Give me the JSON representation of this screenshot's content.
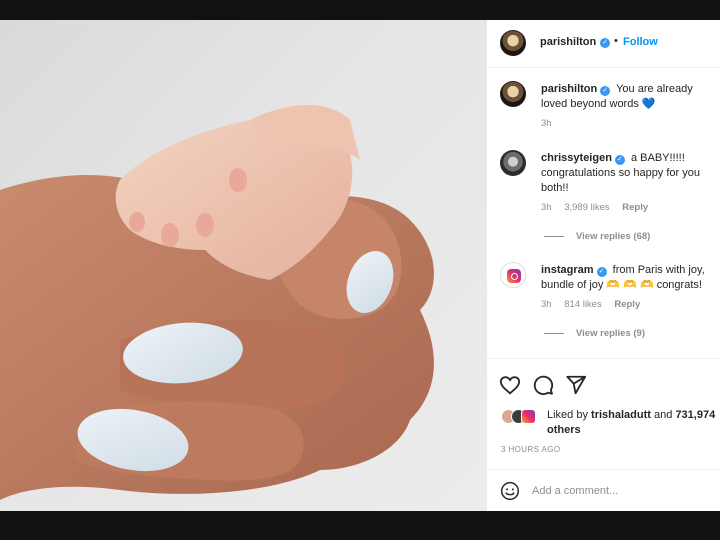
{
  "post": {
    "username": "parishilton",
    "follow_label": "Follow",
    "dot": "•"
  },
  "comments": [
    {
      "username": "parishilton",
      "text": "You are already loved beyond words 💙",
      "time": "3h"
    },
    {
      "username": "chrissyteigen",
      "text": "a BABY!!!!! congratulations so happy for you both!!",
      "time": "3h",
      "likes": "3,989 likes",
      "reply": "Reply",
      "view_replies": "View replies (68)"
    },
    {
      "username": "instagram",
      "text": "from Paris with joy, bundle of joy 🫶 🫶 🫶 congrats!",
      "time": "3h",
      "likes": "814 likes",
      "reply": "Reply",
      "view_replies": "View replies (9)"
    }
  ],
  "actions": {
    "icons": [
      "heart-icon",
      "comment-icon",
      "share-icon"
    ]
  },
  "likes_summary": {
    "prefix": "Liked by",
    "user": "trishaladutt",
    "conj": "and",
    "others": "731,974 others"
  },
  "time_ago": "3 HOURS AGO",
  "composer": {
    "placeholder": "Add a comment...",
    "icon": "emoji-icon"
  },
  "colors": {
    "link_blue": "#0095f6",
    "verified_blue": "#3897f0",
    "muted_text": "#8e8e8e",
    "nail_polish": "#dfe8ef"
  }
}
